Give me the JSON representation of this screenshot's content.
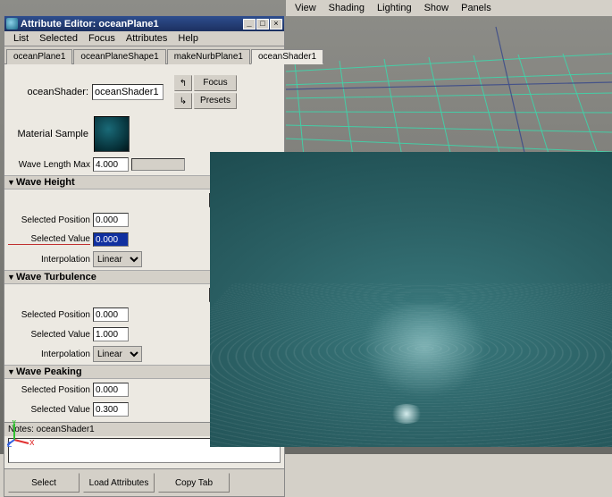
{
  "top_menu": {
    "items": [
      "View",
      "Shading",
      "Lighting",
      "Show",
      "Panels"
    ]
  },
  "window": {
    "title": "Attribute Editor: oceanPlane1"
  },
  "menu": {
    "items": [
      "List",
      "Selected",
      "Focus",
      "Attributes",
      "Help"
    ]
  },
  "tabs": [
    "oceanPlane1",
    "oceanPlaneShape1",
    "makeNurbPlane1",
    "oceanShader1"
  ],
  "active_tab": 3,
  "shader": {
    "label": "oceanShader:",
    "value": "oceanShader1",
    "focus": "Focus",
    "presets": "Presets"
  },
  "material_sample_label": "Material Sample",
  "wave_length": {
    "label": "Wave Length Max",
    "value": "4.000"
  },
  "sections": {
    "wave_height": {
      "title": "Wave Height",
      "selected_position": {
        "label": "Selected Position",
        "value": "0.000"
      },
      "selected_value": {
        "label": "Selected Value",
        "value": "0.000"
      },
      "interpolation": {
        "label": "Interpolation",
        "value": "Linear"
      }
    },
    "wave_turbulence": {
      "title": "Wave Turbulence",
      "selected_position": {
        "label": "Selected Position",
        "value": "0.000"
      },
      "selected_value": {
        "label": "Selected Value",
        "value": "1.000"
      },
      "interpolation": {
        "label": "Interpolation",
        "value": "Linear"
      }
    },
    "wave_peaking": {
      "title": "Wave Peaking",
      "selected_position": {
        "label": "Selected Position",
        "value": "0.000"
      },
      "selected_value": {
        "label": "Selected Value",
        "value": "0.300"
      }
    }
  },
  "notes": {
    "label": "Notes: oceanShader1"
  },
  "buttons": {
    "select": "Select",
    "load": "Load Attributes",
    "copy": "Copy Tab"
  },
  "axis": {
    "x": "x",
    "y": "y",
    "z": "z"
  }
}
